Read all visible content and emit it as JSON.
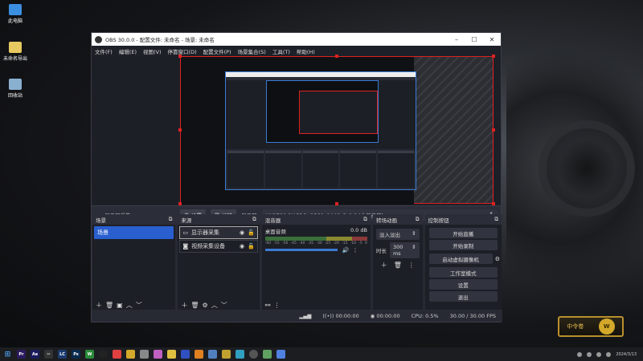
{
  "desktop": {
    "icons": [
      {
        "label": "此电脑",
        "color": "#3b8fe0"
      },
      {
        "label": "未命名导出",
        "color": "#e8c860"
      },
      {
        "label": "回收站",
        "color": "#8ab0d0"
      }
    ]
  },
  "obs": {
    "title": "OBS 30.0.0 - 配置文件: 未命名 - 场景: 未命名",
    "menu": [
      "文件(F)",
      "编辑(E)",
      "视图(V)",
      "停靠窗口(D)",
      "配置文件(P)",
      "场景集合(S)",
      "工具(T)",
      "帮助(H)"
    ],
    "source_bar": {
      "source_name": "显示器采集",
      "settings_label": "设置",
      "filters_label": "滤镜",
      "display_label": "显示器",
      "display_value": "VX2780-2K-PRO: 2560x1440 @ 0,0 (主显示器)"
    },
    "scenes": {
      "title": "场景",
      "items": [
        "场景"
      ]
    },
    "sources": {
      "title": "来源",
      "items": [
        "显示器采集",
        "视频采集设备"
      ]
    },
    "mixer": {
      "title": "混音器",
      "channel": "桌面音频",
      "level": "0.0 dB",
      "ticks": [
        "-60",
        "-55",
        "-50",
        "-45",
        "-40",
        "-35",
        "-30",
        "-25",
        "-20",
        "-15",
        "-10",
        "-5",
        "0"
      ]
    },
    "transitions": {
      "title": "转场动画",
      "type": "淡入淡出",
      "duration_label": "时长",
      "duration_value": "300 ms"
    },
    "controls": {
      "title": "控制按钮",
      "buttons": [
        "开始直播",
        "开始录制",
        "启动虚拟摄像机",
        "工作室模式",
        "设置",
        "退出"
      ]
    },
    "status": {
      "live_time": "00:00:00",
      "rec_time": "00:00:00",
      "cpu": "CPU: 0.5%",
      "fps": "30.00 / 30.00 FPS"
    }
  },
  "wow_badge": {
    "text": "中令卷",
    "logo": "W"
  },
  "taskbar": {
    "apps": [
      {
        "label": "Pr",
        "color": "#2a1a5e"
      },
      {
        "label": "Ae",
        "color": "#1a1a5e"
      },
      {
        "label": "✂",
        "color": "#333"
      },
      {
        "label": "LC",
        "color": "#1a3a6e"
      },
      {
        "label": "Ps",
        "color": "#0a2a4e"
      },
      {
        "label": "W",
        "color": "#2a8a3a"
      }
    ],
    "clock": "2024/3/13"
  },
  "colors": {
    "accent": "#2a5fd0",
    "selection": "#dd2222",
    "window_bg": "#272a33"
  }
}
